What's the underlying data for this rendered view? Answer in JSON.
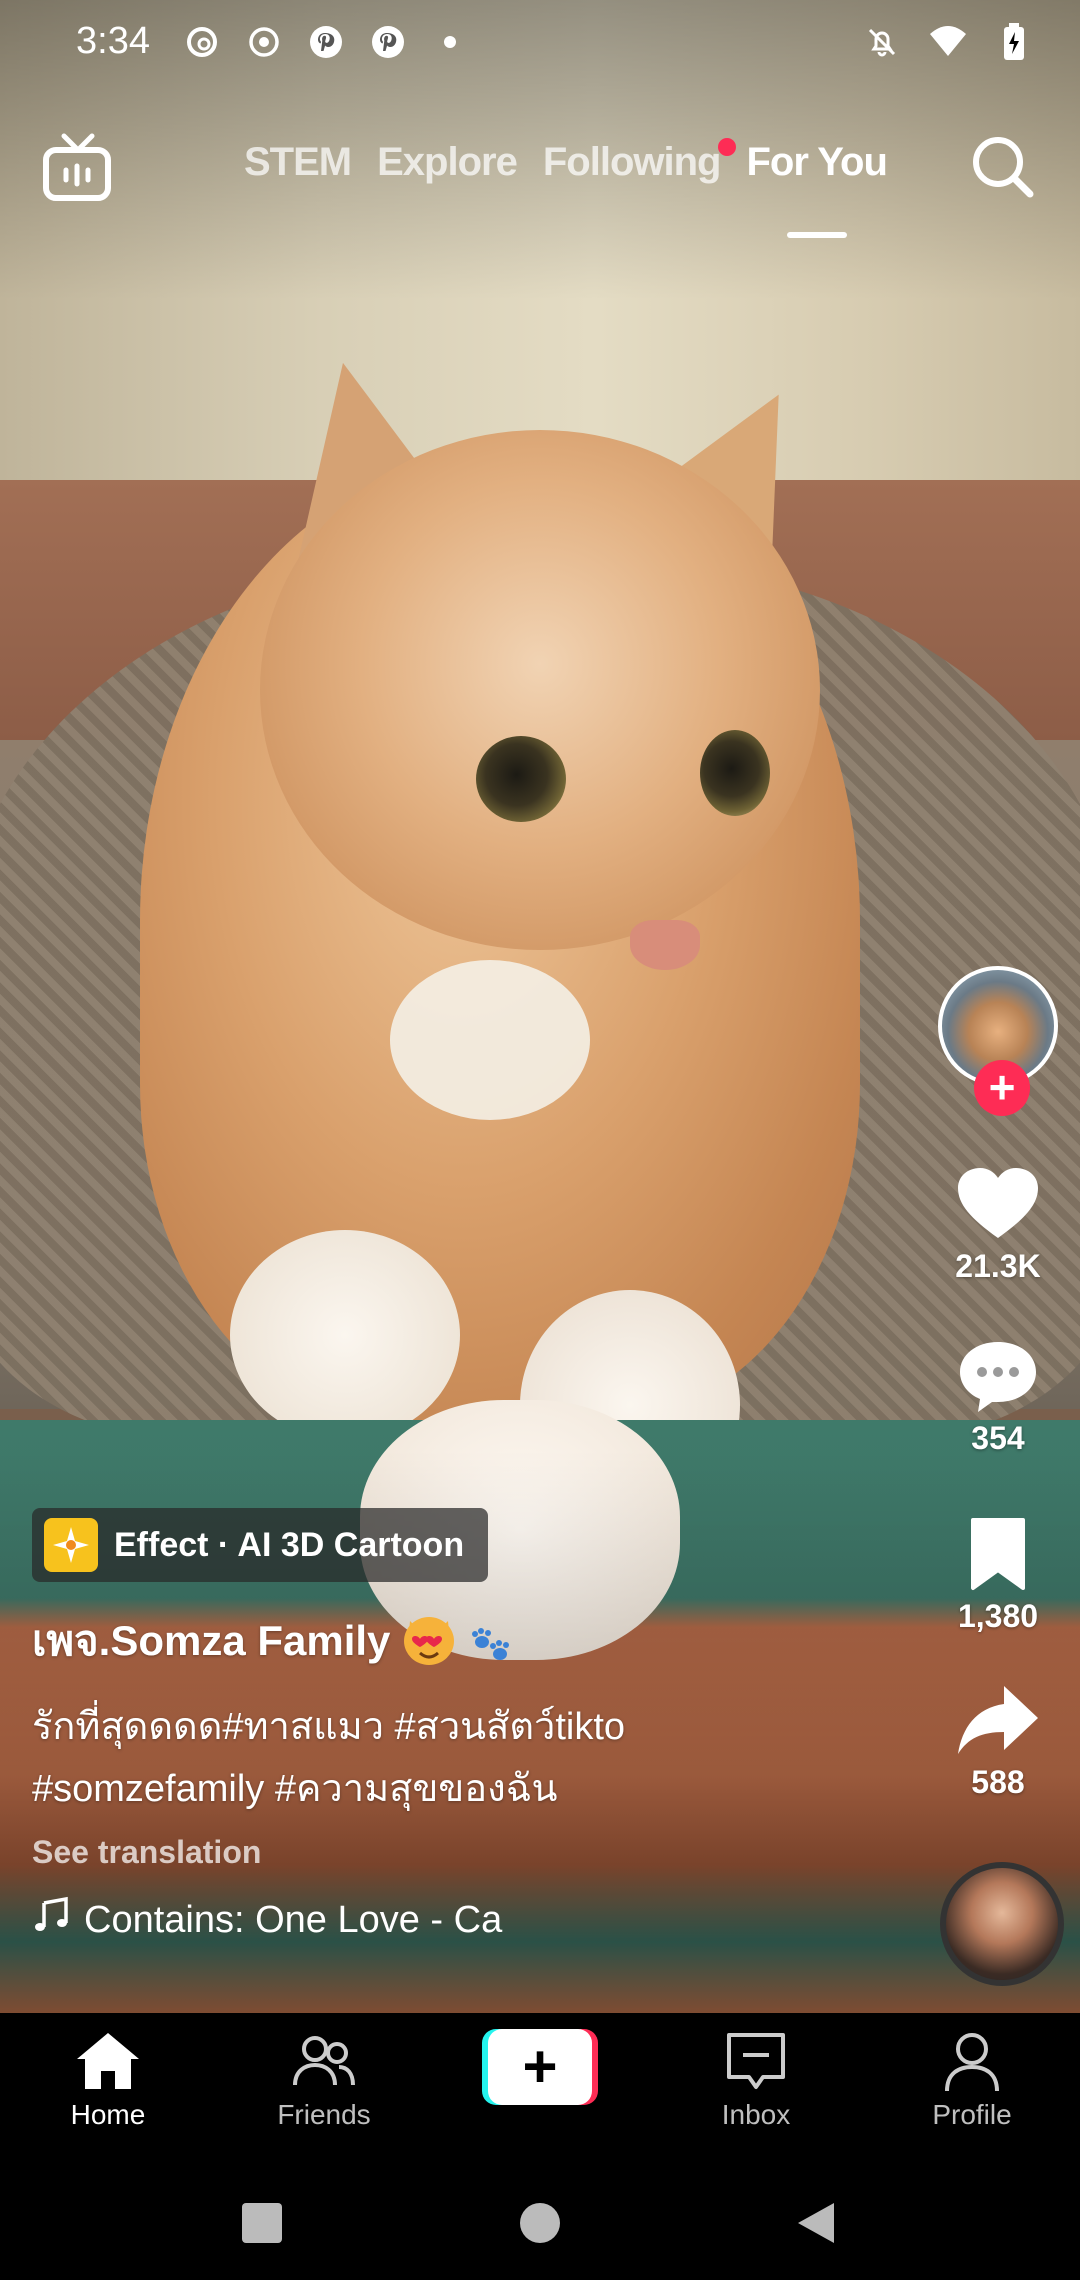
{
  "status_bar": {
    "time": "3:34",
    "left_icons": [
      "threads-icon",
      "record-icon",
      "pinterest-icon",
      "pinterest-icon",
      "dot-icon"
    ],
    "right_icons": [
      "bell-off-icon",
      "wifi-icon",
      "battery-charging-icon"
    ]
  },
  "top_nav": {
    "tabs": [
      {
        "label": "STEM",
        "active": false
      },
      {
        "label": "Explore",
        "active": false
      },
      {
        "label": "Following",
        "active": false,
        "notification_dot": true
      },
      {
        "label": "For You",
        "active": true
      }
    ]
  },
  "actions": {
    "likes": "21.3K",
    "comments": "354",
    "saves": "1,380",
    "shares": "588"
  },
  "post": {
    "effect_label": "Effect · AI 3D Cartoon",
    "username": "เพจ.Somza  Family",
    "caption_line1": "รักที่สุดดดด#ทาสแมว #สวนสัตว์tikto",
    "caption_line2": "#somzefamily #ความสุขของฉัน",
    "see_translation": "See translation",
    "music": "Contains: One Love - Ca"
  },
  "bottom_tabs": [
    {
      "label": "Home",
      "active": true
    },
    {
      "label": "Friends",
      "active": false
    },
    {
      "label": "Inbox",
      "active": false
    },
    {
      "label": "Profile",
      "active": false
    }
  ],
  "colors": {
    "accent": "#fe2c55",
    "cyan": "#25f4ee",
    "effect_icon": "#f7c21d"
  }
}
